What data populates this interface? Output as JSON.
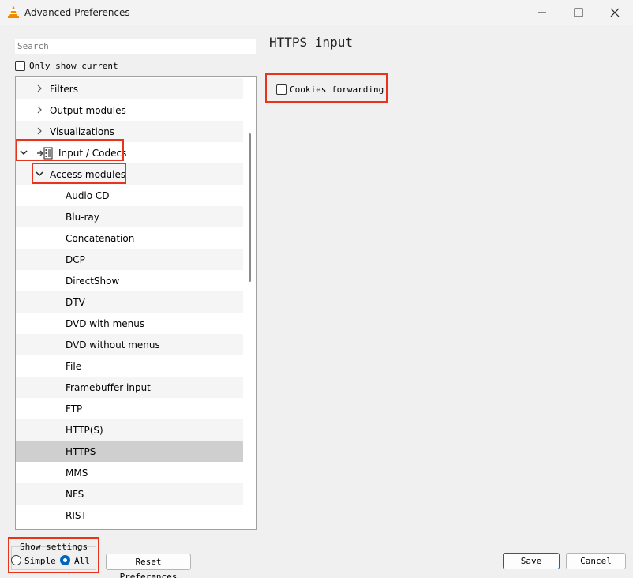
{
  "window": {
    "title": "Advanced Preferences"
  },
  "sidebar": {
    "search_placeholder": "Search",
    "only_show_current_label": "Only show current",
    "tree_items": [
      {
        "label": "Filters"
      },
      {
        "label": "Output modules"
      },
      {
        "label": "Visualizations"
      },
      {
        "label": "Input / Codecs"
      },
      {
        "label": "Access modules"
      },
      {
        "label": "Audio CD"
      },
      {
        "label": "Blu-ray"
      },
      {
        "label": "Concatenation"
      },
      {
        "label": "DCP"
      },
      {
        "label": "DirectShow"
      },
      {
        "label": "DTV"
      },
      {
        "label": "DVD with menus"
      },
      {
        "label": "DVD without menus"
      },
      {
        "label": "File"
      },
      {
        "label": "Framebuffer input"
      },
      {
        "label": "FTP"
      },
      {
        "label": "HTTP(S)"
      },
      {
        "label": "HTTPS"
      },
      {
        "label": "MMS"
      },
      {
        "label": "NFS"
      },
      {
        "label": "RIST"
      }
    ],
    "selected_item": "HTTPS"
  },
  "main": {
    "title": "HTTPS input",
    "cookies_forwarding_label": "Cookies forwarding",
    "cookies_forwarding_checked": false
  },
  "footer": {
    "show_settings_label": "Show settings",
    "simple_label": "Simple",
    "all_label": "All",
    "selected_mode": "All",
    "reset_label": "Reset Preferences",
    "save_label": "Save",
    "cancel_label": "Cancel"
  },
  "colors": {
    "highlight_border": "#e8341c",
    "accent": "#0067c0",
    "vlc_orange": "#f08a00"
  }
}
